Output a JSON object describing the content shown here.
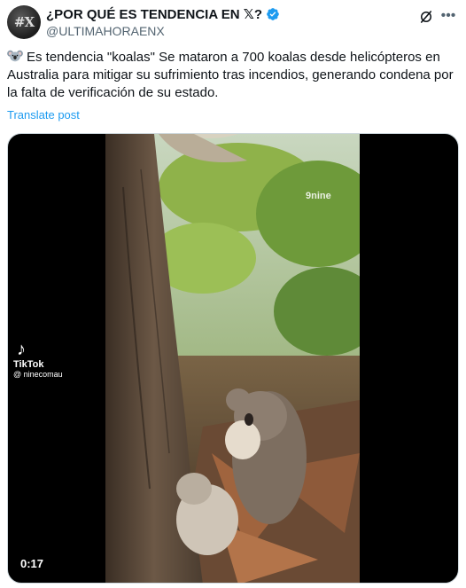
{
  "post": {
    "display_name": "¿POR QUÉ ES TENDENCIA EN 𝕏?",
    "handle": "@ULTIMAHORAENX",
    "avatar_text": "#X",
    "text": "Es tendencia \"koalas\" Se mataron a 700 koalas desde helicópteros en Australia para mitigar su sufrimiento tras incendios, generando condena por la falta de verificación de su estado.",
    "translate_label": "Translate post"
  },
  "video": {
    "duration": "0:17",
    "watermark_brand": "TikTok",
    "watermark_user": "@ ninecomau",
    "channel_logo": "9nine"
  },
  "icons": {
    "verified": "verified-badge-icon",
    "grok": "grok-icon",
    "more": "more-options-icon",
    "koala_emoji": "koala-emoji-icon"
  },
  "colors": {
    "link": "#1d9bf0",
    "verified": "#1d9bf0",
    "secondary_text": "#536471"
  }
}
